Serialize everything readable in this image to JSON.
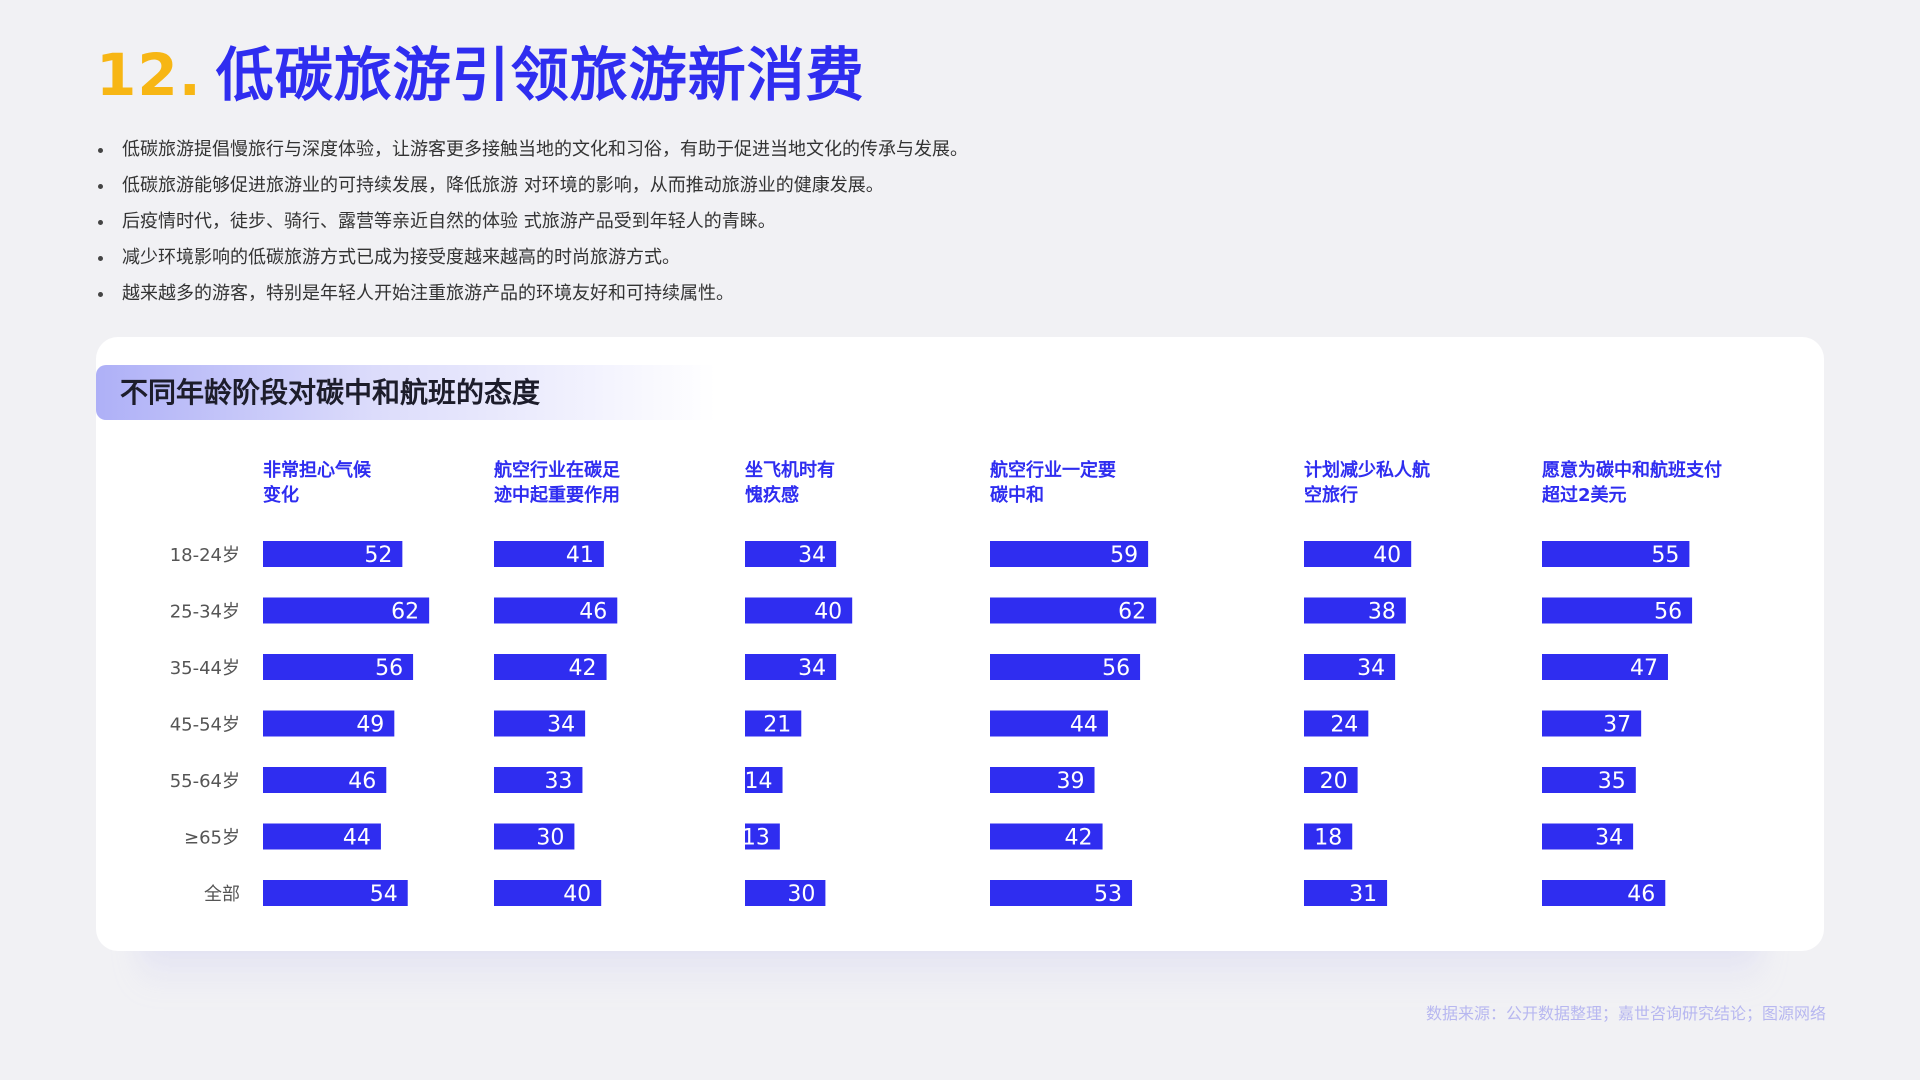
{
  "header": {
    "number": "12.",
    "title": "低碳旅游引领旅游新消费"
  },
  "bullets": [
    "低碳旅游提倡慢旅行与深度体验，让游客更多接触当地的文化和习俗，有助于促进当地文化的传承与发展。",
    "低碳旅游能够促进旅游业的可持续发展，降低旅游 对环境的影响，从而推动旅游业的健康发展。",
    "后疫情时代，徒步、骑行、露营等亲近自然的体验 式旅游产品受到年轻人的青睐。",
    "减少环境影响的低碳旅游方式已成为接受度越来越高的时尚旅游方式。",
    "越来越多的游客，特别是年轻人开始注重旅游产品的环境友好和可持续属性。"
  ],
  "source": "数据来源：公开数据整理；嘉世咨询研究结论；图源网络",
  "colors": {
    "accent": "#2f2df0",
    "number": "#f7b614",
    "bar_text": "#ffffff"
  },
  "chart_data": {
    "type": "bar",
    "title": "不同年龄阶段对碳中和航班的态度",
    "categories": [
      "18-24岁",
      "25-34岁",
      "35-44岁",
      "45-54岁",
      "55-64岁",
      "≥65岁",
      "全部"
    ],
    "series": [
      {
        "name": "非常担心气候变化",
        "name_lines": [
          "非常担心气候",
          "变化"
        ],
        "values": [
          52,
          62,
          56,
          49,
          46,
          44,
          54
        ]
      },
      {
        "name": "航空行业在碳足迹中起重要作用",
        "name_lines": [
          "航空行业在碳足",
          "迹中起重要作用"
        ],
        "values": [
          41,
          46,
          42,
          34,
          33,
          30,
          40
        ]
      },
      {
        "name": "坐飞机时有愧疚感",
        "name_lines": [
          "坐飞机时有",
          "愧疚感"
        ],
        "values": [
          34,
          40,
          34,
          21,
          14,
          13,
          30
        ]
      },
      {
        "name": "航空行业一定要碳中和",
        "name_lines": [
          "航空行业一定要",
          "碳中和"
        ],
        "values": [
          59,
          62,
          56,
          44,
          39,
          42,
          53
        ]
      },
      {
        "name": "计划减少私人航空旅行",
        "name_lines": [
          "计划减少私人航",
          "空旅行"
        ],
        "values": [
          40,
          38,
          34,
          24,
          20,
          18,
          31
        ]
      },
      {
        "name": "愿意为碳中和航班支付超过2美元",
        "name_lines": [
          "愿意为碳中和航班支付",
          "超过2美元"
        ],
        "values": [
          55,
          56,
          47,
          37,
          35,
          34,
          46
        ]
      }
    ]
  }
}
